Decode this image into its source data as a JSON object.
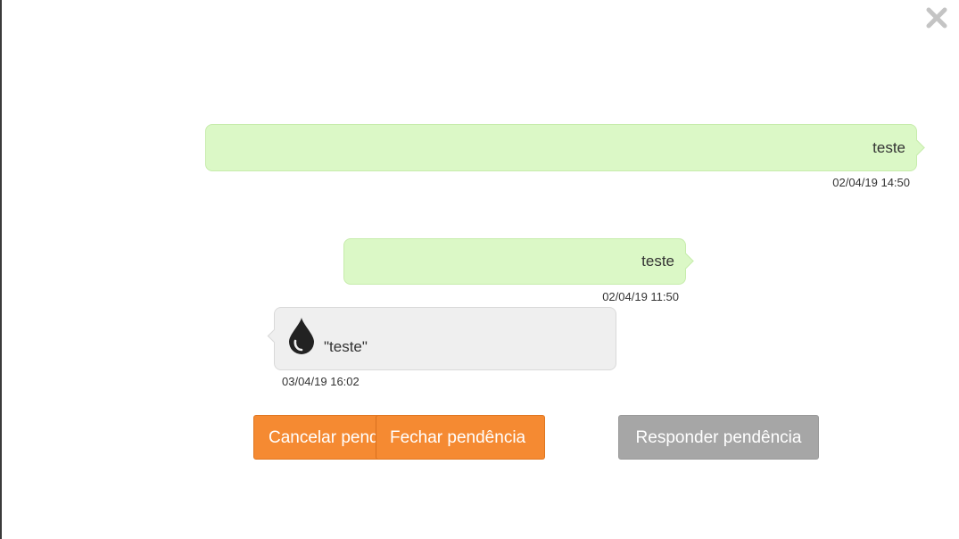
{
  "dialog": {
    "close_icon": "close-icon"
  },
  "messages": [
    {
      "direction": "outgoing",
      "text": "teste",
      "timestamp": "02/04/19 14:50"
    },
    {
      "direction": "outgoing",
      "text": "teste",
      "timestamp": "02/04/19 11:50"
    },
    {
      "direction": "incoming",
      "icon": "drop-icon",
      "text": "\"teste\"",
      "timestamp": "03/04/19 16:02"
    }
  ],
  "actions": {
    "cancel_label": "Cancelar pendência",
    "close_label": "Fechar pendência",
    "reply_label": "Responder pendência"
  },
  "colors": {
    "outgoing_bubble": "#dbf8c6",
    "incoming_bubble": "#efefef",
    "primary_button": "#f58a32",
    "secondary_button": "#a6a6a6"
  }
}
